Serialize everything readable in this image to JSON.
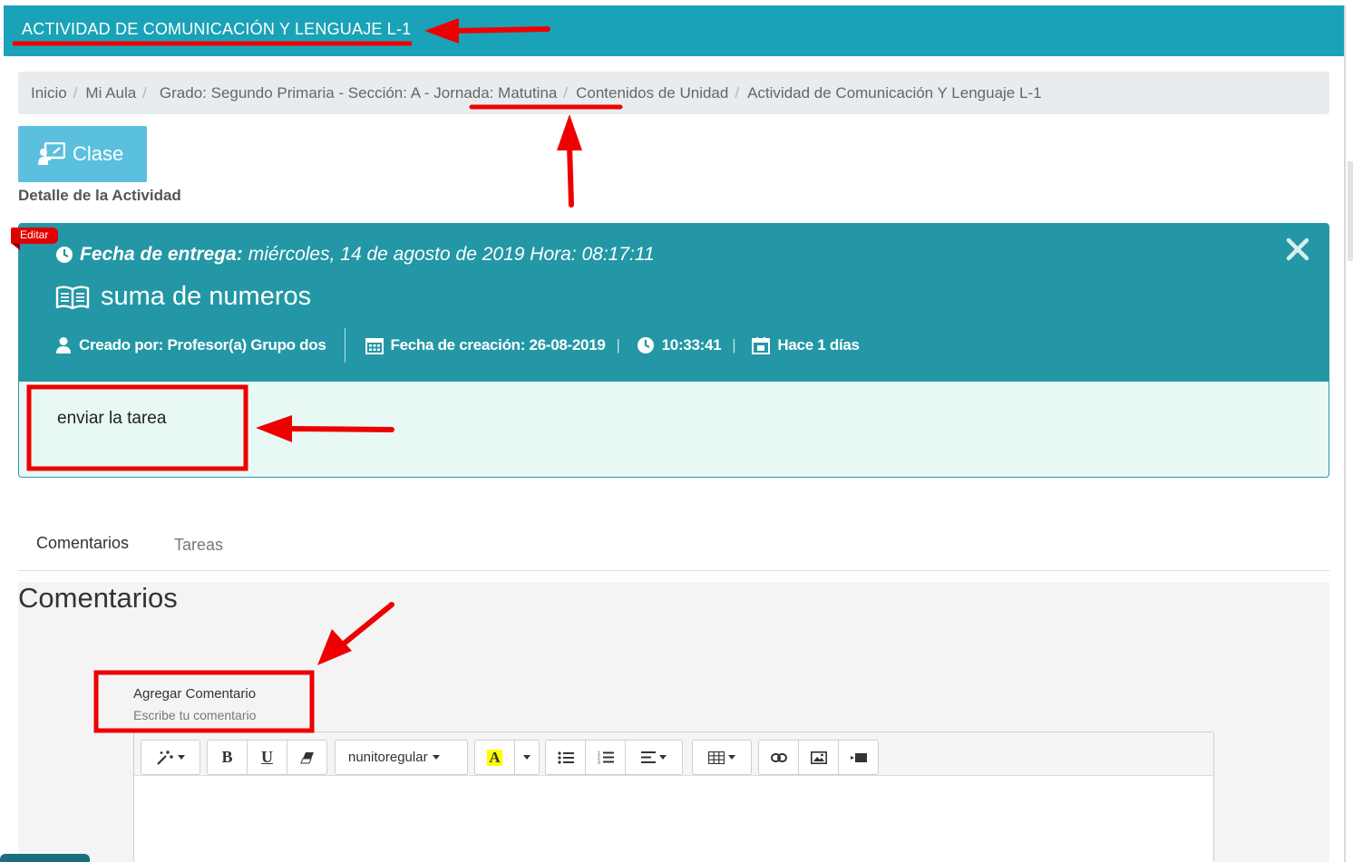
{
  "header": {
    "title": "ACTIVIDAD DE COMUNICACIÓN Y LENGUAJE L-1"
  },
  "breadcrumb": {
    "items": [
      "Inicio",
      "Mi Aula",
      "Grado: Segundo Primaria - Sección: A - Jornada: Matutina",
      "Contenidos de Unidad",
      "Actividad de Comunicación Y Lenguaje L-1"
    ]
  },
  "clase_button": {
    "label": "Clase"
  },
  "section_title": "Detalle de la Actividad",
  "card": {
    "edit_tag": "Editar",
    "due_label": "Fecha de entrega:",
    "due_value": "miércoles, 14 de agosto de 2019 Hora: 08:17:11",
    "title": "suma de numeros",
    "created_by": "Creado por: Profesor(a) Grupo dos",
    "created_date": "Fecha de creación: 26-08-2019",
    "created_time": "10:33:41",
    "ago": "Hace 1 días",
    "description": "enviar la tarea"
  },
  "tabs": [
    {
      "label": "Comentarios",
      "active": true
    },
    {
      "label": "Tareas",
      "active": false
    }
  ],
  "comments": {
    "heading": "Comentarios",
    "add_label": "Agregar Comentario",
    "add_placeholder": "Escribe tu comentario"
  },
  "editor_toolbar": {
    "font_name": "nunitoregular",
    "bold": "B",
    "underline": "U",
    "color_letter": "A",
    "icons": [
      "magic-icon",
      "bold-icon",
      "underline-icon",
      "eraser-icon",
      "font-dropdown",
      "text-color-icon",
      "unordered-list-icon",
      "ordered-list-icon",
      "align-icon",
      "table-icon",
      "link-icon",
      "picture-icon",
      "video-icon"
    ]
  },
  "colors": {
    "header": "#1aa3b8",
    "card_header": "#2397a5",
    "card_body": "#e8f8f5",
    "clase_button": "#5bc0de",
    "annotation": "#e00000"
  }
}
